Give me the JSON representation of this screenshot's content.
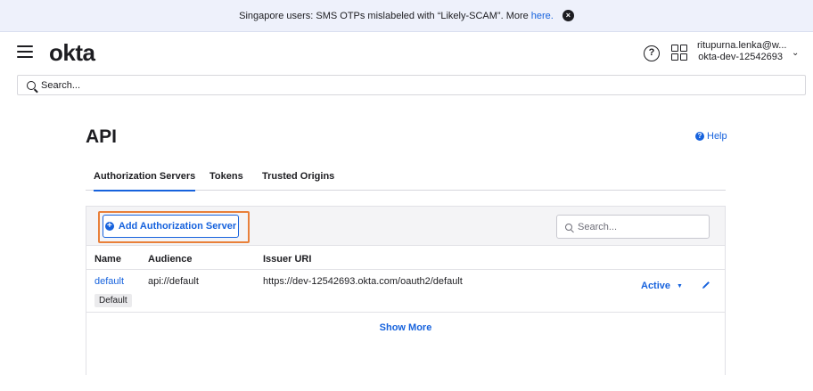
{
  "banner": {
    "message": "Singapore users: SMS OTPs mislabeled with “Likely-SCAM”. More",
    "link_text": "here.",
    "close_icon": "close-icon"
  },
  "header": {
    "logo": "okta",
    "user_name": "ritupurna.lenka@w...",
    "org": "okta-dev-12542693",
    "help_glyph": "?"
  },
  "global_search": {
    "placeholder": "Search..."
  },
  "page": {
    "title": "API",
    "help_label": "Help"
  },
  "tabs": [
    {
      "label": "Authorization Servers",
      "active": true
    },
    {
      "label": "Tokens",
      "active": false
    },
    {
      "label": "Trusted Origins",
      "active": false
    }
  ],
  "toolbar": {
    "add_button_label": "Add Authorization Server",
    "search_placeholder": "Search..."
  },
  "table": {
    "columns": [
      "Name",
      "Audience",
      "Issuer URI"
    ],
    "rows": [
      {
        "name": "default",
        "badge": "Default",
        "audience": "api://default",
        "issuer_uri": "https://dev-12542693.okta.com/oauth2/default",
        "status": "Active"
      }
    ],
    "show_more": "Show More"
  },
  "colors": {
    "accent": "#1662dd",
    "highlight": "#e9803a",
    "banner_bg": "#eef1fb"
  }
}
